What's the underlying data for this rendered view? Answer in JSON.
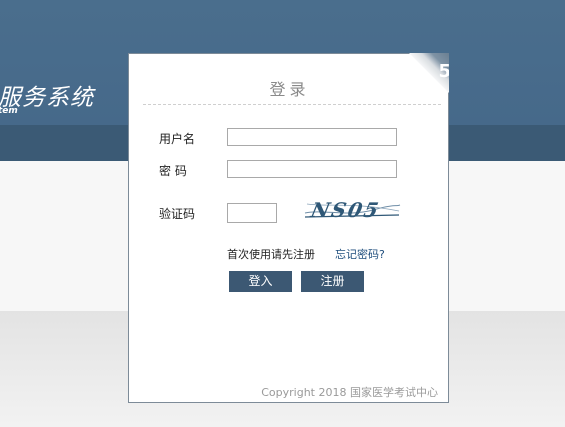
{
  "header": {
    "title": "服务系统",
    "subtitle": "tem"
  },
  "login": {
    "title": "登录",
    "corner_mark": "5",
    "username_label": "用户名",
    "password_label": "密 码",
    "captcha_label": "验证码",
    "username_value": "",
    "password_value": "",
    "captcha_value": "",
    "captcha_text": "NS05",
    "register_hint": "首次使用请先注册",
    "forgot_link": "忘记密码?",
    "login_button": "登入",
    "register_button": "注册",
    "copyright": "Copyright 2018 国家医学考试中心"
  },
  "colors": {
    "header": "#46698a",
    "header_band": "#3b5a75",
    "button": "#3c5873",
    "link": "#1f4e7d",
    "captcha_ink": "#2f5877"
  }
}
